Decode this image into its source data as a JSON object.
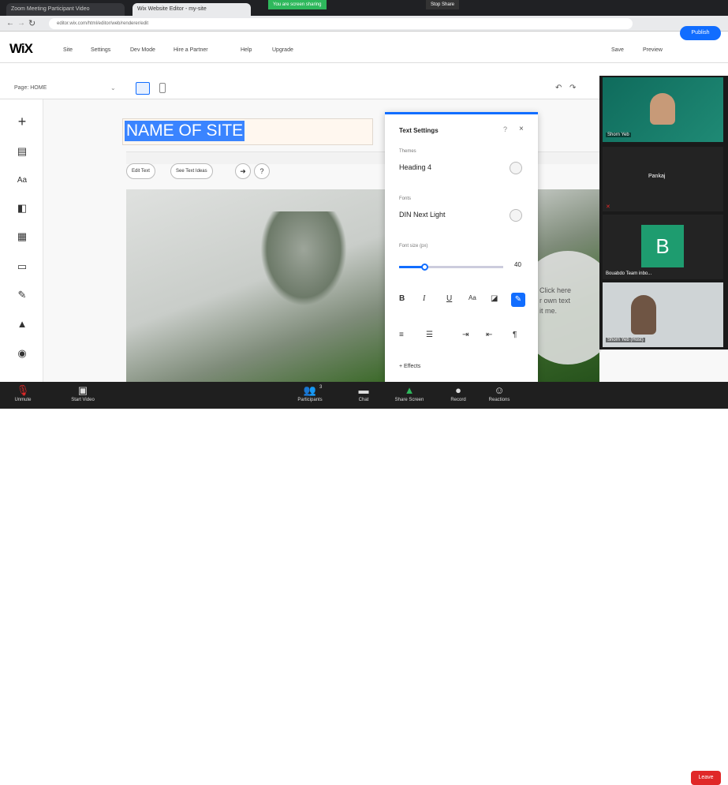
{
  "browser": {
    "tabs": [
      {
        "label": "Zoom Meeting Participant Video"
      },
      {
        "label": "Wix Website Editor - my-site"
      }
    ],
    "share_banner": "You are screen sharing",
    "stop_share": "Stop Share",
    "url": "editor.wix.com/html/editor/web/renderer/edit"
  },
  "wix": {
    "logo": "WiX",
    "menu": [
      "Site",
      "Settings",
      "Dev Mode",
      "Hire a Partner",
      "Help",
      "Upgrade"
    ],
    "save": "Save",
    "preview": "Preview",
    "publish": "Publish",
    "page_select": "Page: HOME"
  },
  "canvas": {
    "site_name": "NAME OF SITE",
    "edit_text": "Edit Text",
    "see_text_ideas": "See Text Ideas",
    "click_here_text": "Click here\nr own text\nit me."
  },
  "text_settings": {
    "title": "Text Settings",
    "theme_label": "Themes",
    "theme_value": "Heading 4",
    "font_label": "Fonts",
    "font_value": "DIN Next Light",
    "size_label": "Font size (px)",
    "size_value": "40",
    "size_fraction": 0.25,
    "effects": "+ Effects"
  },
  "video": {
    "tile1_name": "Shorn Yeb",
    "tile2_name": "Pankaj",
    "tile3_letter": "B",
    "tile3_name": "Bouabdo Team inbo...",
    "tile4_name": "Shorn Yeb (Host)"
  },
  "zoom": {
    "mute": "Unmute",
    "video": "Start Video",
    "participants": "Participants",
    "participants_count": "3",
    "chat": "Chat",
    "share": "Share Screen",
    "record": "Record",
    "reactions": "Reactions",
    "end": "Leave"
  },
  "colors": {
    "wix_blue": "#116dff",
    "share_green": "#2eb85c",
    "end_red": "#e02828"
  }
}
